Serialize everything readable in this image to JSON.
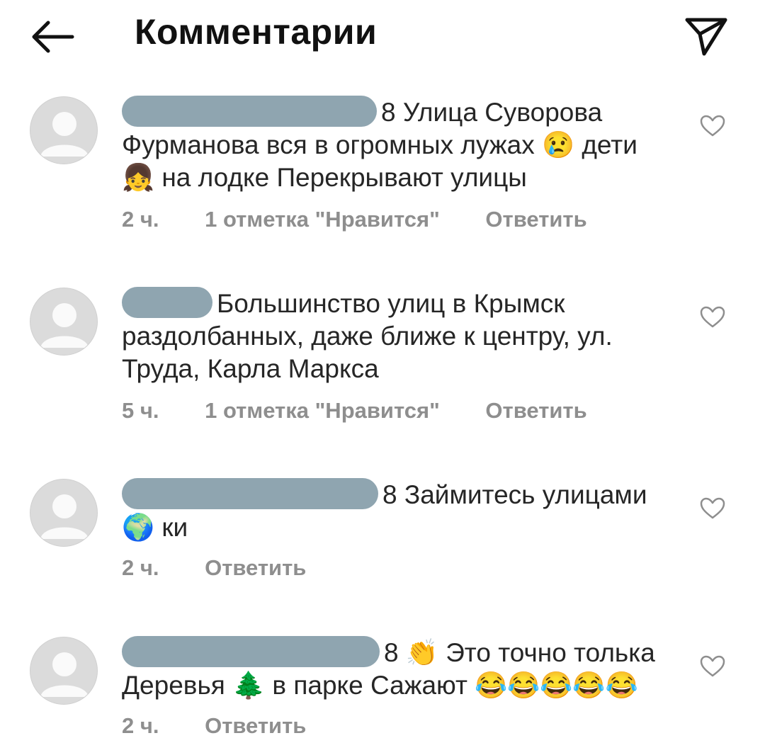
{
  "header": {
    "title": "Комментарии",
    "back_icon": "arrow-left-icon",
    "send_icon": "paper-plane-icon"
  },
  "comments": [
    {
      "text": "8 Улица Суворова Фурманова вся в огромных лужах 😢 дети 👧 на лодке Перекрывают улицы",
      "time": "2 ч.",
      "likes": "1 отметка \"Нравится\"",
      "reply": "Ответить"
    },
    {
      "text": "Большинство улиц в Крымск раздолбанных, даже ближе к центру, ул. Труда, Карла Маркса",
      "time": "5 ч.",
      "likes": "1 отметка \"Нравится\"",
      "reply": "Ответить"
    },
    {
      "text": "8 Займитесь улицами 🌍 ки",
      "time": "2 ч.",
      "reply": "Ответить"
    },
    {
      "text": "8 👏 Это точно толька Деревья 🌲 в парке Сажают 😂😂😂😂😂",
      "time": "2 ч.",
      "reply": "Ответить"
    }
  ],
  "colors": {
    "text": "#262626",
    "meta": "#8e8e8e",
    "redaction": "#8fa5b0"
  }
}
